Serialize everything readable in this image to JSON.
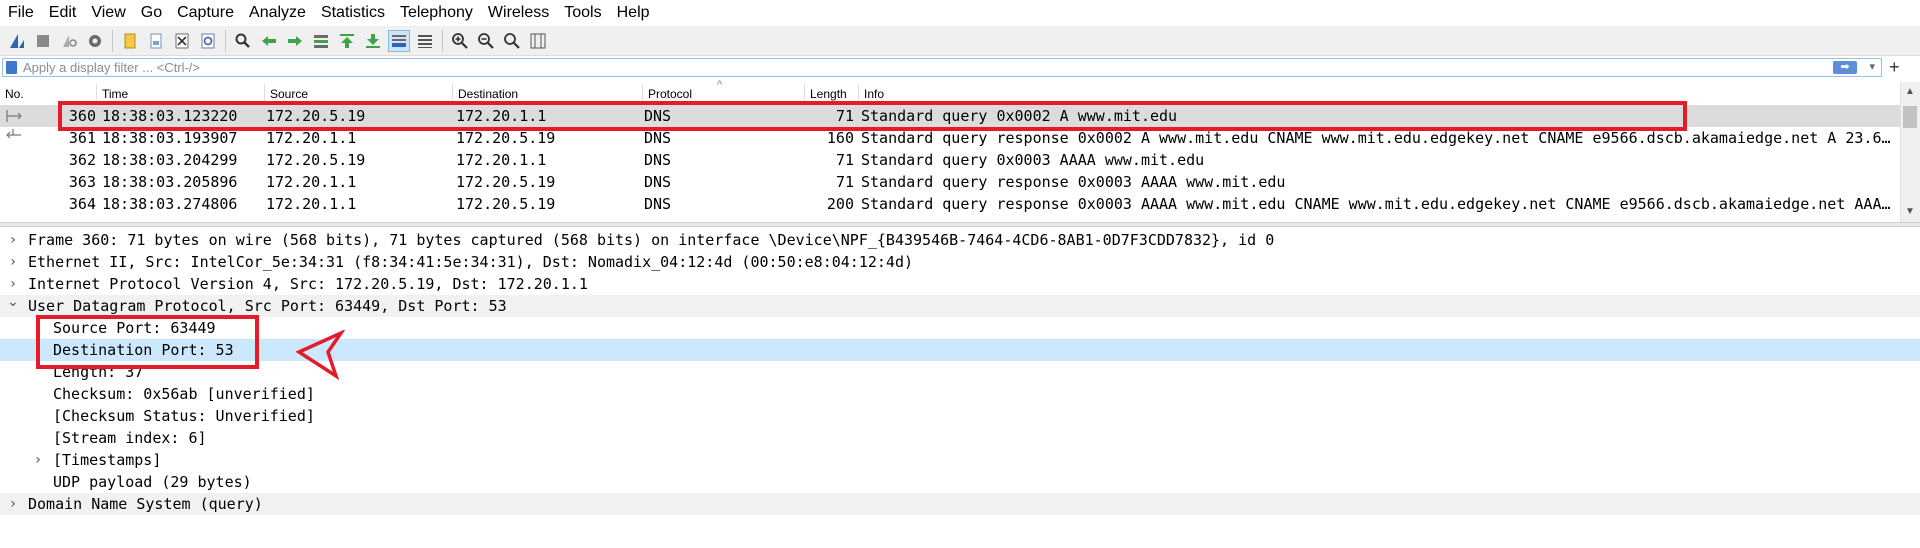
{
  "menu": [
    "File",
    "Edit",
    "View",
    "Go",
    "Capture",
    "Analyze",
    "Statistics",
    "Telephony",
    "Wireless",
    "Tools",
    "Help"
  ],
  "toolbar": {
    "icons": [
      "shark-fin-icon",
      "stop-icon",
      "restart-icon",
      "options-gear-icon",
      "open-file-icon",
      "save-file-icon",
      "close-file-icon",
      "reload-icon",
      "find-icon",
      "go-back-icon",
      "go-forward-icon",
      "go-to-packet-icon",
      "first-packet-icon",
      "last-packet-icon",
      "autoscroll-icon",
      "colorize-icon",
      "zoom-in-icon",
      "zoom-out-icon",
      "zoom-normal-icon",
      "resize-columns-icon"
    ]
  },
  "filter": {
    "placeholder": "Apply a display filter ... <Ctrl-/>",
    "apply_glyph": "➡",
    "dropdown_glyph": "▾",
    "add_glyph": "+"
  },
  "packet_list": {
    "columns": [
      "No.",
      "Time",
      "Source",
      "Destination",
      "Protocol",
      "Length",
      "Info"
    ],
    "sort_glyph": "^",
    "rows": [
      {
        "no": "360",
        "time": "18:38:03.123220",
        "src": "172.20.5.19",
        "dst": "172.20.1.1",
        "proto": "DNS",
        "len": "71",
        "info": "Standard query 0x0002 A www.mit.edu",
        "selected": true
      },
      {
        "no": "361",
        "time": "18:38:03.193907",
        "src": "172.20.1.1",
        "dst": "172.20.5.19",
        "proto": "DNS",
        "len": "160",
        "info": "Standard query response 0x0002 A www.mit.edu CNAME www.mit.edu.edgekey.net CNAME e9566.dscb.akamaiedge.net A 23.6…",
        "selected": false
      },
      {
        "no": "362",
        "time": "18:38:03.204299",
        "src": "172.20.5.19",
        "dst": "172.20.1.1",
        "proto": "DNS",
        "len": "71",
        "info": "Standard query 0x0003 AAAA www.mit.edu",
        "selected": false
      },
      {
        "no": "363",
        "time": "18:38:03.205896",
        "src": "172.20.1.1",
        "dst": "172.20.5.19",
        "proto": "DNS",
        "len": "71",
        "info": "Standard query response 0x0003 AAAA www.mit.edu",
        "selected": false
      },
      {
        "no": "364",
        "time": "18:38:03.274806",
        "src": "172.20.1.1",
        "dst": "172.20.5.19",
        "proto": "DNS",
        "len": "200",
        "info": "Standard query response 0x0003 AAAA www.mit.edu CNAME www.mit.edu.edgekey.net CNAME e9566.dscb.akamaiedge.net AAA…",
        "selected": false
      }
    ]
  },
  "details": {
    "frame": "Frame 360: 71 bytes on wire (568 bits), 71 bytes captured (568 bits) on interface \\Device\\NPF_{B439546B-7464-4CD6-8AB1-0D7F3CDD7832}, id 0",
    "ethernet": "Ethernet II, Src: IntelCor_5e:34:31 (f8:34:41:5e:34:31), Dst: Nomadix_04:12:4d (00:50:e8:04:12:4d)",
    "ip": "Internet Protocol Version 4, Src: 172.20.5.19, Dst: 172.20.1.1",
    "udp": "User Datagram Protocol, Src Port: 63449, Dst Port: 53",
    "src_port": "Source Port: 63449",
    "dst_port": "Destination Port: 53",
    "length": "Length: 37",
    "checksum": "Checksum: 0x56ab [unverified]",
    "checksum_status": "[Checksum Status: Unverified]",
    "stream_index": "[Stream index: 6]",
    "timestamps": "[Timestamps]",
    "payload": "UDP payload (29 bytes)",
    "dns": "Domain Name System (query)",
    "collapsed_glyph": "›",
    "expanded_glyph": "⌄"
  },
  "colors": {
    "annotation_red": "#e21c2a",
    "selected_row": "#dcdcdc",
    "highlight_row": "#cce8ff"
  }
}
